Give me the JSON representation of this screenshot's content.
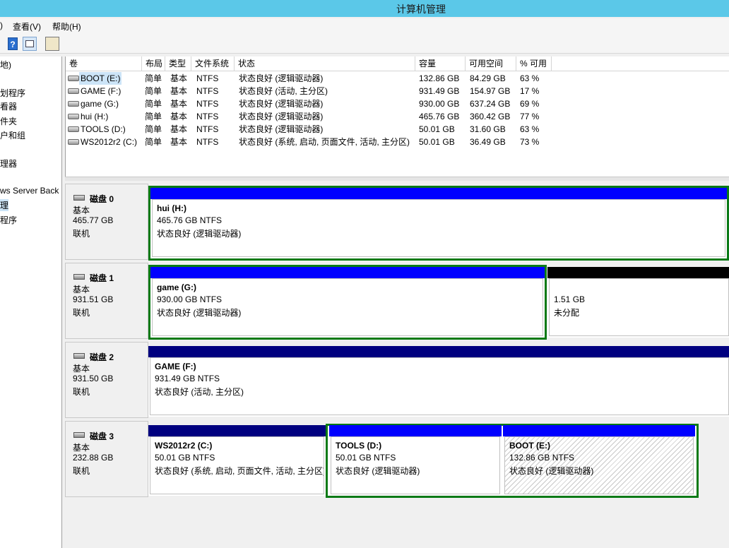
{
  "window": {
    "title": "计算机管理"
  },
  "menu": {
    "item1": ")",
    "view": "查看(V)",
    "help": "帮助(H)"
  },
  "toolbar": {
    "help_glyph": "?"
  },
  "sidebar": {
    "items": [
      "地)",
      "划程序",
      "看器",
      "件夹",
      "户和组",
      "理器",
      "ws Server Back",
      "理",
      "程序"
    ]
  },
  "volume_list": {
    "columns": [
      "卷",
      "布局",
      "类型",
      "文件系统",
      "状态",
      "容量",
      "可用空间",
      "% 可用"
    ],
    "rows": [
      {
        "name": "BOOT (E:)",
        "layout": "简单",
        "type": "基本",
        "fs": "NTFS",
        "status": "状态良好 (逻辑驱动器)",
        "capacity": "132.86 GB",
        "free": "84.29 GB",
        "pct": "63 %"
      },
      {
        "name": "GAME (F:)",
        "layout": "简单",
        "type": "基本",
        "fs": "NTFS",
        "status": "状态良好 (活动, 主分区)",
        "capacity": "931.49 GB",
        "free": "154.97 GB",
        "pct": "17 %"
      },
      {
        "name": "game (G:)",
        "layout": "简单",
        "type": "基本",
        "fs": "NTFS",
        "status": "状态良好 (逻辑驱动器)",
        "capacity": "930.00 GB",
        "free": "637.24 GB",
        "pct": "69 %"
      },
      {
        "name": "hui (H:)",
        "layout": "简单",
        "type": "基本",
        "fs": "NTFS",
        "status": "状态良好 (逻辑驱动器)",
        "capacity": "465.76 GB",
        "free": "360.42 GB",
        "pct": "77 %"
      },
      {
        "name": "TOOLS (D:)",
        "layout": "简单",
        "type": "基本",
        "fs": "NTFS",
        "status": "状态良好 (逻辑驱动器)",
        "capacity": "50.01 GB",
        "free": "31.60 GB",
        "pct": "63 %"
      },
      {
        "name": "WS2012r2 (C:)",
        "layout": "简单",
        "type": "基本",
        "fs": "NTFS",
        "status": "状态良好 (系统, 启动, 页面文件, 活动, 主分区)",
        "capacity": "50.01 GB",
        "free": "36.49 GB",
        "pct": "73 %"
      }
    ]
  },
  "disks": [
    {
      "name": "磁盘 0",
      "type": "基本",
      "size": "465.77 GB",
      "state": "联机",
      "parts": [
        {
          "title": "hui  (H:)",
          "size": "465.76 GB NTFS",
          "status": "状态良好 (逻辑驱动器)"
        }
      ]
    },
    {
      "name": "磁盘 1",
      "type": "基本",
      "size": "931.51 GB",
      "state": "联机",
      "parts": [
        {
          "title": "game  (G:)",
          "size": "930.00 GB NTFS",
          "status": "状态良好 (逻辑驱动器)"
        },
        {
          "title": "",
          "size": "1.51 GB",
          "status": "未分配"
        }
      ]
    },
    {
      "name": "磁盘 2",
      "type": "基本",
      "size": "931.50 GB",
      "state": "联机",
      "parts": [
        {
          "title": "GAME  (F:)",
          "size": "931.49 GB NTFS",
          "status": "状态良好 (活动, 主分区)"
        }
      ]
    },
    {
      "name": "磁盘 3",
      "type": "基本",
      "size": "232.88 GB",
      "state": "联机",
      "parts": [
        {
          "title": "WS2012r2  (C:)",
          "size": "50.01 GB NTFS",
          "status": "状态良好 (系统, 启动, 页面文件, 活动, 主分区)"
        },
        {
          "title": "TOOLS  (D:)",
          "size": "50.01 GB NTFS",
          "status": "状态良好 (逻辑驱动器)"
        },
        {
          "title": "BOOT  (E:)",
          "size": "132.86 GB NTFS",
          "status": "状态良好 (逻辑驱动器)"
        }
      ]
    }
  ],
  "colors": {
    "titlebar": "#5bc8e8",
    "logical_bar": "#0000ff",
    "primary_bar": "#00007f",
    "unallocated_bar": "#000000",
    "extended_border": "#0a7a16",
    "selection": "#cce4f7"
  },
  "icons": {
    "drive": "drive-icon",
    "disk": "disk-icon",
    "help": "help-icon",
    "view": "view-icon",
    "properties": "properties-icon"
  }
}
